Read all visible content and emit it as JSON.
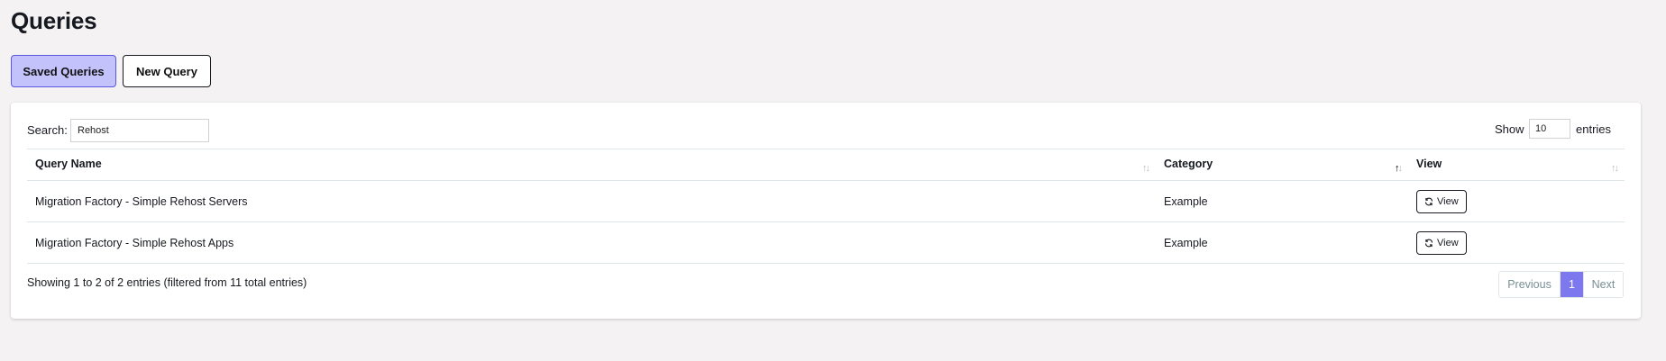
{
  "page": {
    "title": "Queries"
  },
  "tabs": [
    {
      "label": "Saved Queries",
      "active": true
    },
    {
      "label": "New Query",
      "active": false
    }
  ],
  "search": {
    "label": "Search:",
    "value": "Rehost"
  },
  "length": {
    "show_label": "Show",
    "value": "10",
    "entries_label": "entries"
  },
  "table": {
    "columns": [
      "Query Name",
      "Category",
      "View"
    ],
    "sorted_column": "Category",
    "rows": [
      {
        "name": "Migration Factory - Simple Rehost Servers",
        "category": "Example",
        "action": "View"
      },
      {
        "name": "Migration Factory - Simple Rehost Apps",
        "category": "Example",
        "action": "View"
      }
    ]
  },
  "info": "Showing 1 to 2 of 2 entries (filtered from 11 total entries)",
  "pagination": {
    "previous": "Previous",
    "current": "1",
    "next": "Next"
  },
  "colors": {
    "accent": "#7d78ee",
    "active_tab_bg": "#c4c2fb",
    "background": "#f4f2f3"
  },
  "icons": {
    "view_button": "refresh-icon",
    "sort": "sort-arrows-icon"
  }
}
